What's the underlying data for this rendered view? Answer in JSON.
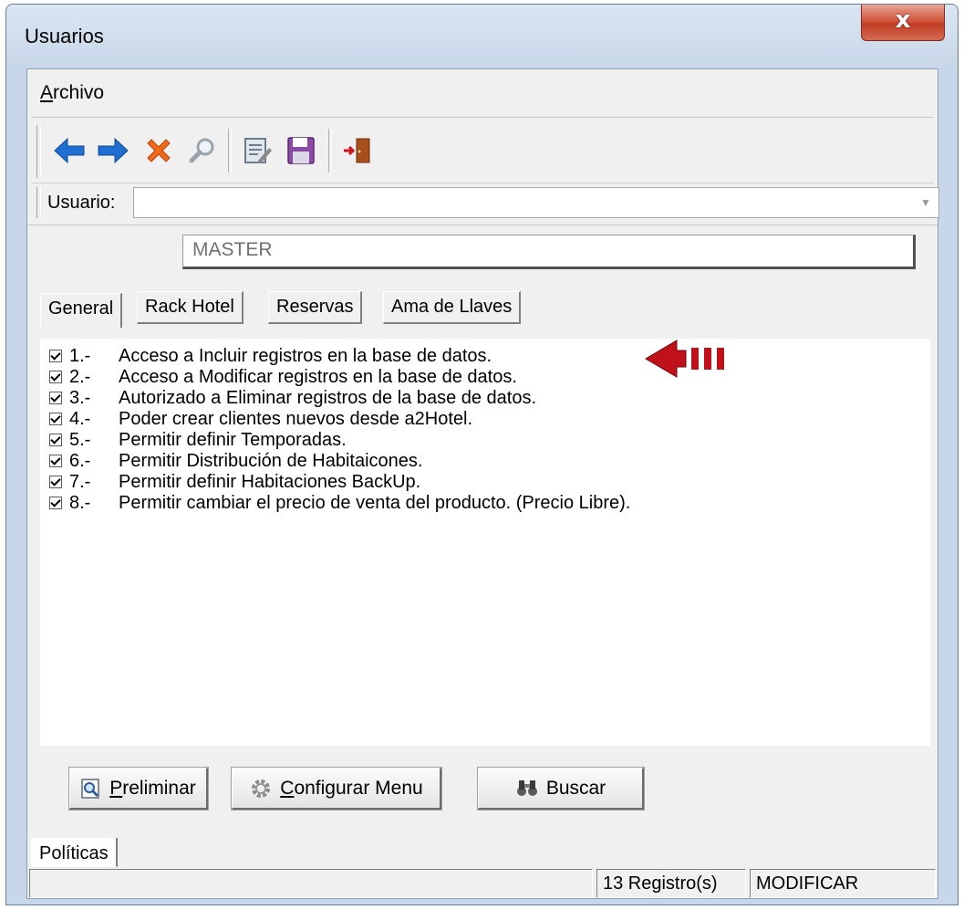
{
  "window": {
    "title": "Usuarios",
    "close_label": "x"
  },
  "menu": {
    "archivo_first": "A",
    "archivo_rest": "rchivo"
  },
  "toolbar": {
    "icons": [
      "arrow-left-icon",
      "arrow-right-icon",
      "delete-x-icon",
      "search-magnifier-icon",
      "edit-notes-icon",
      "save-floppy-icon",
      "exit-door-icon"
    ]
  },
  "user_bar": {
    "label": "Usuario:",
    "value": ""
  },
  "user_name": "MASTER",
  "tabs": [
    {
      "label": "General",
      "active": true
    },
    {
      "label": "Rack Hotel",
      "active": false
    },
    {
      "label": "Reservas",
      "active": false
    },
    {
      "label": "Ama de Llaves",
      "active": false
    }
  ],
  "permissions": [
    {
      "num": "1.-",
      "text": "Acceso a Incluir registros en la base de datos.",
      "checked": true
    },
    {
      "num": "2.-",
      "text": "Acceso a Modificar registros en la base de datos.",
      "checked": true
    },
    {
      "num": "3.-",
      "text": "Autorizado a Eliminar registros de la base de datos.",
      "checked": true
    },
    {
      "num": "4.-",
      "text": "Poder crear clientes nuevos desde a2Hotel.",
      "checked": true
    },
    {
      "num": "5.-",
      "text": "Permitir definir Temporadas.",
      "checked": true
    },
    {
      "num": "6.-",
      "text": "Permitir Distribución de Habitaicones.",
      "checked": true
    },
    {
      "num": "7.-",
      "text": "Permitir definir Habitaciones BackUp.",
      "checked": true
    },
    {
      "num": "8.-",
      "text": "Permitir cambiar el precio de venta del producto. (Precio Libre).",
      "checked": true
    }
  ],
  "buttons": {
    "preliminar_first": "P",
    "preliminar_rest": "reliminar",
    "configurar_first": "C",
    "configurar_rest": "onfigurar Menu",
    "buscar": "Buscar"
  },
  "bottom_tab": "Políticas",
  "status": {
    "left": "",
    "count": "13 Registro(s)",
    "mode": "MODIFICAR"
  },
  "colors": {
    "accent_blue": "#1f6fd1",
    "delete_orange": "#f06a1a",
    "arrow_red": "#c0101a"
  }
}
